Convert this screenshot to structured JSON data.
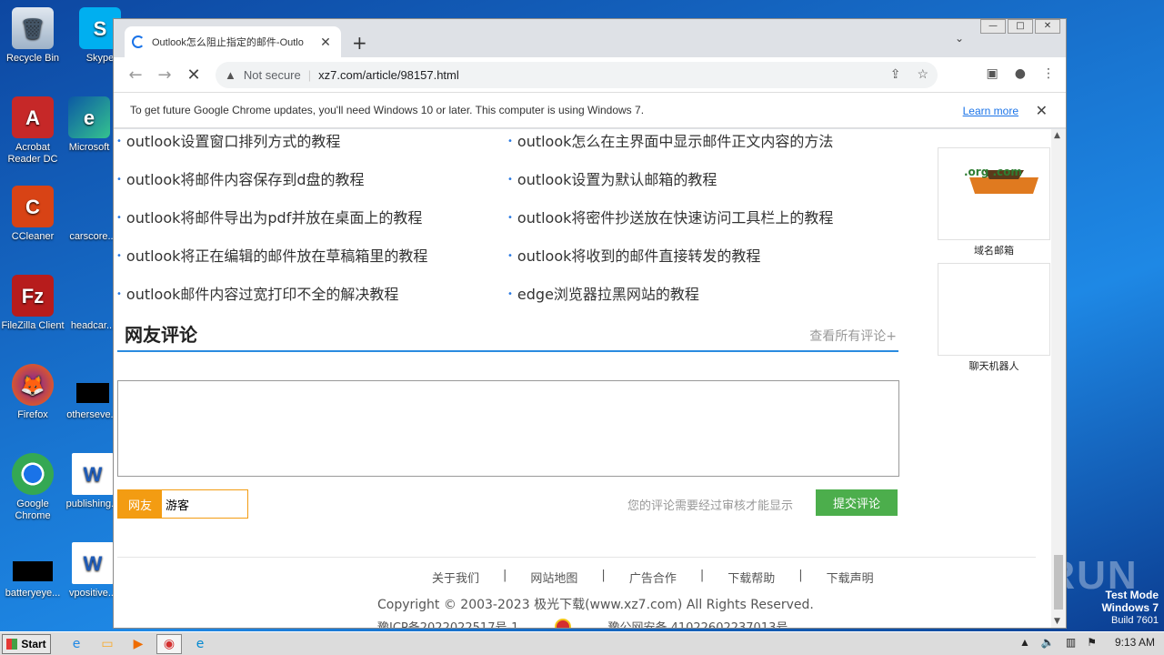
{
  "desktop": {
    "icons": [
      {
        "label": "Recycle Bin",
        "name": "recycle-bin"
      },
      {
        "label": "Skype",
        "name": "skype"
      },
      {
        "label": "Acrobat Reader DC",
        "name": "acrobat"
      },
      {
        "label": "Microsoft",
        "name": "edge"
      },
      {
        "label": "CCleaner",
        "name": "ccleaner"
      },
      {
        "label": "carscore...",
        "name": "carscore"
      },
      {
        "label": "FileZilla Client",
        "name": "filezilla"
      },
      {
        "label": "headcar...",
        "name": "headcar"
      },
      {
        "label": "Firefox",
        "name": "firefox"
      },
      {
        "label": "otherseve...",
        "name": "otherseve"
      },
      {
        "label": "Google Chrome",
        "name": "chrome"
      },
      {
        "label": "publishing...",
        "name": "publishing"
      },
      {
        "label": "batteryeye...",
        "name": "batteryeye"
      },
      {
        "label": "vpositive...",
        "name": "vpositive"
      }
    ],
    "watermark": "ANY RUN",
    "test_mode": {
      "line1": "Test Mode",
      "line2": "Windows 7",
      "line3": "Build 7601"
    }
  },
  "browser": {
    "tab_title": "Outlook怎么阻止指定的邮件-Outlo",
    "new_tab": "+",
    "not_secure": "Not secure",
    "url": "xz7.com/article/98157.html",
    "infobar_text": "To get future Google Chrome updates, you'll need Windows 10 or later. This computer is using Windows 7.",
    "learn_more": "Learn more"
  },
  "page": {
    "articles_left": [
      "outlook设置窗口排列方式的教程",
      "outlook将邮件内容保存到d盘的教程",
      "outlook将邮件导出为pdf并放在桌面上的教程",
      "outlook将正在编辑的邮件放在草稿箱里的教程",
      "outlook邮件内容过宽打印不全的解决教程"
    ],
    "articles_right": [
      "outlook怎么在主界面中显示邮件正文内容的方法",
      "outlook设置为默认邮箱的教程",
      "outlook将密件抄送放在快速访问工具栏上的教程",
      "outlook将收到的邮件直接转发的教程",
      "edge浏览器拉黑网站的教程"
    ],
    "comments_heading": "网友评论",
    "view_all": "查看所有评论+",
    "nick_label": "网友",
    "nick_value": "游客",
    "review_note": "您的评论需要经过审核才能显示",
    "submit": "提交评论",
    "footer_links": [
      "关于我们",
      "网站地图",
      "广告合作",
      "下载帮助",
      "下载声明"
    ],
    "footer_sep": "|",
    "copyright": "Copyright © 2003-2023 极光下载(www.xz7.com) All Rights Reserved.",
    "icp": "豫ICP备2022022517号-1",
    "police": "豫公网安备 41022602237013号",
    "side": [
      {
        "caption": "域名邮箱",
        "art": ".org .com"
      },
      {
        "caption": "聊天机器人"
      }
    ]
  },
  "taskbar": {
    "start": "Start",
    "time": "9:13 AM"
  }
}
